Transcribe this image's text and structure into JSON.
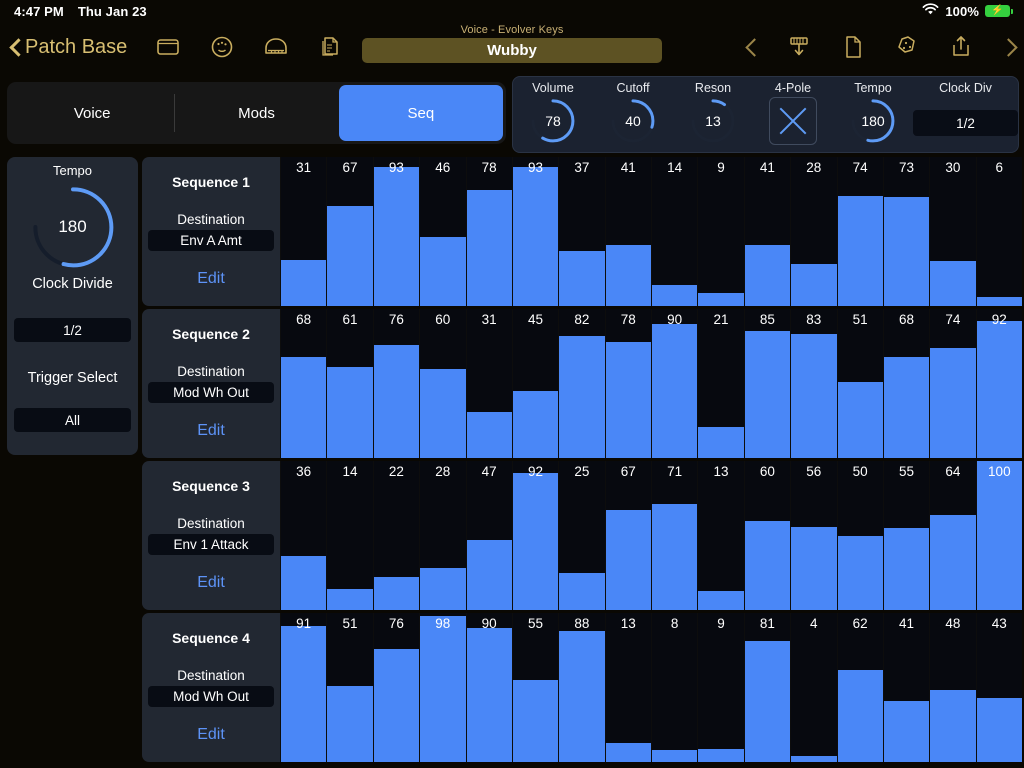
{
  "status_bar": {
    "time": "4:47 PM",
    "date": "Thu Jan 23",
    "battery_percent": "100%",
    "wifi_icon": "wifi-icon",
    "battery_icon": "battery-charging-icon"
  },
  "nav": {
    "back_label": "Patch Base",
    "back_icon": "chevron-left-icon",
    "left_icons": [
      "window-icon",
      "palette-icon",
      "piano-icon",
      "copy-document-icon"
    ],
    "patch_subtitle": "Voice - Evolver Keys",
    "patch_name": "Wubby",
    "right_icons": [
      "chevron-left-icon",
      "download-icon",
      "document-icon",
      "randomize-dice-icon",
      "share-icon",
      "chevron-right-icon"
    ]
  },
  "tabs": [
    {
      "label": "Voice",
      "active": false
    },
    {
      "label": "Mods",
      "active": false
    },
    {
      "label": "Seq",
      "active": true
    }
  ],
  "params": [
    {
      "label": "Volume",
      "value": "78",
      "type": "knob",
      "pct": 78
    },
    {
      "label": "Cutoff",
      "value": "40",
      "type": "knob",
      "pct": 40
    },
    {
      "label": "Reson",
      "value": "13",
      "type": "knob",
      "pct": 13
    },
    {
      "label": "4-Pole",
      "value": "X",
      "type": "toggle",
      "pct": 0
    },
    {
      "label": "Tempo",
      "value": "180",
      "type": "knob",
      "pct": 72
    },
    {
      "label": "Clock Div",
      "value": "1/2",
      "type": "field",
      "pct": 0
    }
  ],
  "sidebar": {
    "tempo_label": "Tempo",
    "tempo_value": "180",
    "tempo_pct": 72,
    "clock_divide_label": "Clock Divide",
    "clock_divide_value": "1/2",
    "trigger_select_label": "Trigger Select",
    "trigger_select_value": "All"
  },
  "sequences": [
    {
      "title": "Sequence 1",
      "destination_label": "Destination",
      "destination": "Env A Amt",
      "edit_label": "Edit",
      "steps": [
        31,
        67,
        93,
        46,
        78,
        93,
        37,
        41,
        14,
        9,
        41,
        28,
        74,
        73,
        30,
        6
      ]
    },
    {
      "title": "Sequence 2",
      "destination_label": "Destination",
      "destination": "Mod Wh Out",
      "edit_label": "Edit",
      "steps": [
        68,
        61,
        76,
        60,
        31,
        45,
        82,
        78,
        90,
        21,
        85,
        83,
        51,
        68,
        74,
        92
      ]
    },
    {
      "title": "Sequence 3",
      "destination_label": "Destination",
      "destination": "Env 1 Attack",
      "edit_label": "Edit",
      "steps": [
        36,
        14,
        22,
        28,
        47,
        92,
        25,
        67,
        71,
        13,
        60,
        56,
        50,
        55,
        64,
        100
      ]
    },
    {
      "title": "Sequence 4",
      "destination_label": "Destination",
      "destination": "Mod Wh Out",
      "edit_label": "Edit",
      "steps": [
        91,
        51,
        76,
        98,
        90,
        55,
        88,
        13,
        8,
        9,
        81,
        4,
        62,
        41,
        48,
        43
      ]
    }
  ],
  "colors": {
    "accent_blue": "#4a87f7",
    "gold": "#c9ad5f",
    "panel": "#222832",
    "field": "#080c14",
    "battery_green": "#35d03f"
  }
}
